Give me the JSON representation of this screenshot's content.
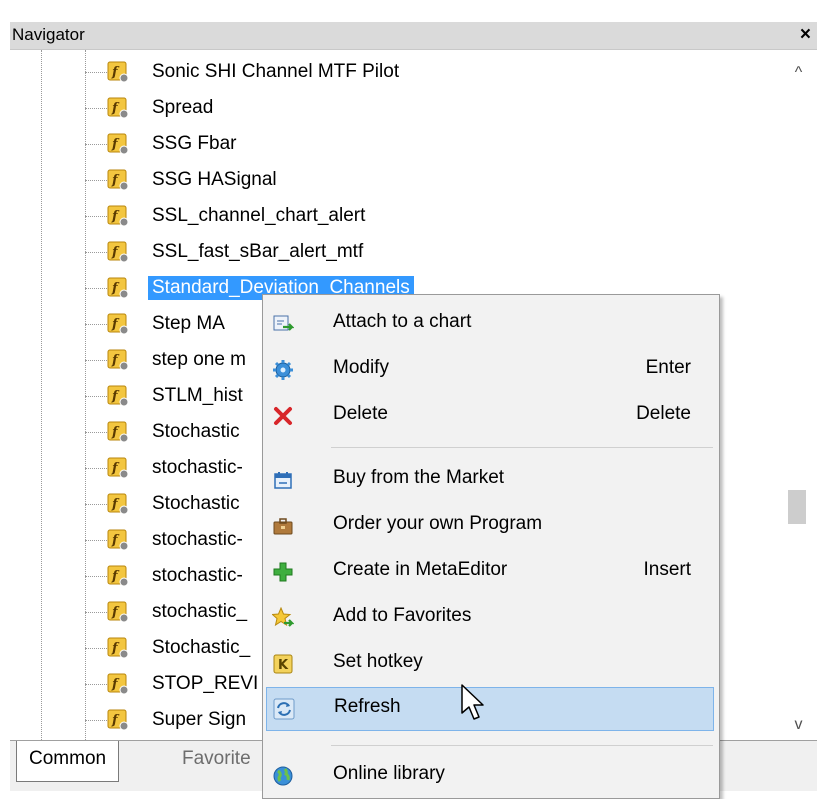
{
  "navigator": {
    "title": "Navigator",
    "close_glyph": "×",
    "items": [
      {
        "label": "Sonic SHI Channel MTF Pilot",
        "icon": "custom-indicator-icon"
      },
      {
        "label": "Spread",
        "icon": "custom-indicator-icon"
      },
      {
        "label": "SSG Fbar",
        "icon": "custom-indicator-icon"
      },
      {
        "label": "SSG HASignal",
        "icon": "custom-indicator-icon"
      },
      {
        "label": "SSL_channel_chart_alert",
        "icon": "custom-indicator-icon"
      },
      {
        "label": "SSL_fast_sBar_alert_mtf",
        "icon": "custom-indicator-icon"
      },
      {
        "label": "Standard_Deviation_Channels",
        "icon": "custom-indicator-icon",
        "selected": true
      },
      {
        "label": "Step MA",
        "icon": "custom-indicator-icon"
      },
      {
        "label": "step one m",
        "icon": "custom-indicator-icon"
      },
      {
        "label": "STLM_hist",
        "icon": "custom-indicator-icon"
      },
      {
        "label": "Stochastic",
        "icon": "custom-indicator-icon"
      },
      {
        "label": "stochastic-",
        "icon": "custom-indicator-icon"
      },
      {
        "label": "Stochastic",
        "icon": "custom-indicator-icon"
      },
      {
        "label": "stochastic-",
        "icon": "custom-indicator-icon"
      },
      {
        "label": "stochastic-",
        "icon": "custom-indicator-icon"
      },
      {
        "label": "stochastic_",
        "icon": "custom-indicator-icon"
      },
      {
        "label": "Stochastic_",
        "icon": "custom-indicator-icon"
      },
      {
        "label": "STOP_REVI",
        "icon": "custom-indicator-icon"
      },
      {
        "label": "Super Sign",
        "icon": "custom-indicator-icon"
      }
    ],
    "tabs": [
      {
        "label": "Common",
        "active": true
      },
      {
        "label": "Favorite",
        "active": false
      }
    ],
    "scroll_up_glyph": "^",
    "scroll_down_glyph": "v"
  },
  "context_menu": {
    "items": [
      {
        "label": "Attach to a chart",
        "shortcut": "",
        "icon": "attach-chart-icon"
      },
      {
        "label": "Modify",
        "shortcut": "Enter",
        "icon": "gear-icon"
      },
      {
        "label": "Delete",
        "shortcut": "Delete",
        "icon": "delete-x-icon"
      },
      {
        "label": "Buy from the Market",
        "shortcut": "",
        "icon": "market-icon"
      },
      {
        "label": "Order your own Program",
        "shortcut": "",
        "icon": "briefcase-icon"
      },
      {
        "label": "Create in MetaEditor",
        "shortcut": "Insert",
        "icon": "plus-icon"
      },
      {
        "label": "Add to Favorites",
        "shortcut": "",
        "icon": "favorite-star-icon"
      },
      {
        "label": "Set hotkey",
        "shortcut": "",
        "icon": "hotkey-icon"
      },
      {
        "label": "Refresh",
        "shortcut": "",
        "icon": "refresh-icon",
        "hovered": true
      },
      {
        "label": "Online library",
        "shortcut": "",
        "icon": "globe-icon"
      }
    ]
  },
  "colors": {
    "selection": "#3399ff",
    "menu_hover": "#c5dcf2",
    "menu_hover_border": "#7eb4ea",
    "title_bar": "#dadada"
  }
}
